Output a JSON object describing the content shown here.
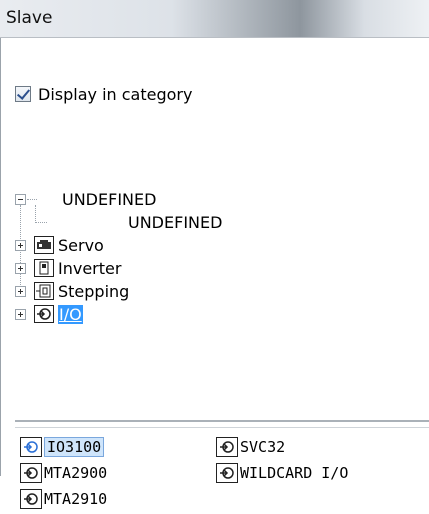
{
  "window": {
    "title": "Slave"
  },
  "display_in_category": {
    "label": "Display in category",
    "checked": true
  },
  "tree": {
    "root": "UNDEFINED",
    "root_child": "UNDEFINED",
    "categories": [
      {
        "label": "Servo",
        "icon": "servo-icon"
      },
      {
        "label": "Inverter",
        "icon": "inverter-icon"
      },
      {
        "label": "Stepping",
        "icon": "stepping-icon"
      },
      {
        "label": "I/O",
        "icon": "io-icon",
        "selected": true
      }
    ]
  },
  "slave_list": {
    "items": [
      {
        "label": "IO3100",
        "selected": true
      },
      {
        "label": "SVC32"
      },
      {
        "label": "MTA2900"
      },
      {
        "label": "WILDCARD I/O"
      },
      {
        "label": "MTA2910"
      }
    ]
  }
}
